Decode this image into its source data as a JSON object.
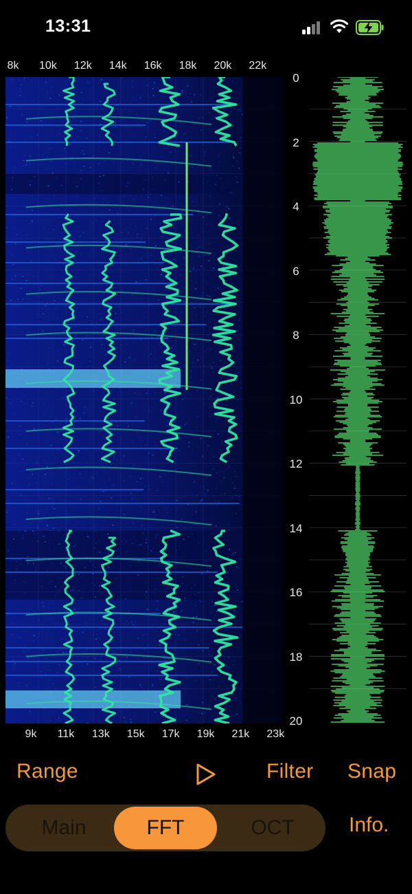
{
  "status_bar": {
    "time": "13:31",
    "icons": [
      "cellular-signal-icon",
      "wifi-icon",
      "battery-charging-icon"
    ]
  },
  "spectrogram": {
    "top_freq_labels": [
      "8k",
      "10k",
      "12k",
      "14k",
      "16k",
      "18k",
      "20k",
      "22k"
    ],
    "bottom_freq_labels": [
      "9k",
      "11k",
      "13k",
      "15k",
      "17k",
      "19k",
      "21k",
      "23k"
    ],
    "time_labels": [
      "0",
      "2",
      "4",
      "6",
      "8",
      "10",
      "12",
      "14",
      "16",
      "18",
      "20"
    ],
    "colors": {
      "background": "#03062a",
      "low": "#0b1a7a",
      "mid": "#1d5fd8",
      "high": "#2fe6a0",
      "peak": "#7dff6a"
    }
  },
  "waveform": {
    "color": "#4fd36a"
  },
  "controls": {
    "range_label": "Range",
    "play_icon": "play-icon",
    "filter_label": "Filter",
    "snap_label": "Snap"
  },
  "tabs": {
    "items": [
      {
        "label": "Main",
        "active": false
      },
      {
        "label": "FFT",
        "active": true
      },
      {
        "label": "OCT",
        "active": false
      }
    ],
    "info_label": "Info."
  },
  "accent_color": "#f29a3b"
}
